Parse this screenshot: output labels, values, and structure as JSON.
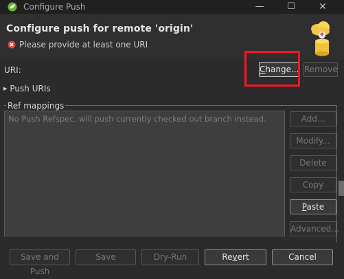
{
  "window": {
    "title": "Configure Push",
    "minimize_glyph": "—",
    "maximize_glyph": "☐",
    "close_glyph": "✕"
  },
  "header": {
    "heading": "Configure push for remote 'origin'",
    "error_message": "Please provide at least one URI",
    "error_icon": "error-icon",
    "banner_icon": "push-cloud-icon"
  },
  "uri": {
    "label": "URI:",
    "change_label_u": "C",
    "change_label_rest": "hange...",
    "remove_label": "Remove"
  },
  "push_uris": {
    "triangle": "▶",
    "label": "Push URIs"
  },
  "ref_mappings": {
    "group_label": "Ref mappings",
    "hint": "No Push Refspec, will push currently checked out branch instead.",
    "buttons": {
      "add": "Add...",
      "modify": "Modify...",
      "delete": "Delete",
      "copy": "Copy",
      "paste_u": "P",
      "paste_rest": "aste",
      "advanced": "Advanced..."
    }
  },
  "footer": {
    "save_and_push": "Save and Push",
    "save": "Save",
    "dry_run": "Dry-Run",
    "revert_pre": "Re",
    "revert_u": "v",
    "revert_post": "ert",
    "cancel": "Cancel"
  },
  "colors": {
    "highlight": "#ff1522",
    "error": "#e0403f",
    "app_icon": "#6db33f"
  }
}
